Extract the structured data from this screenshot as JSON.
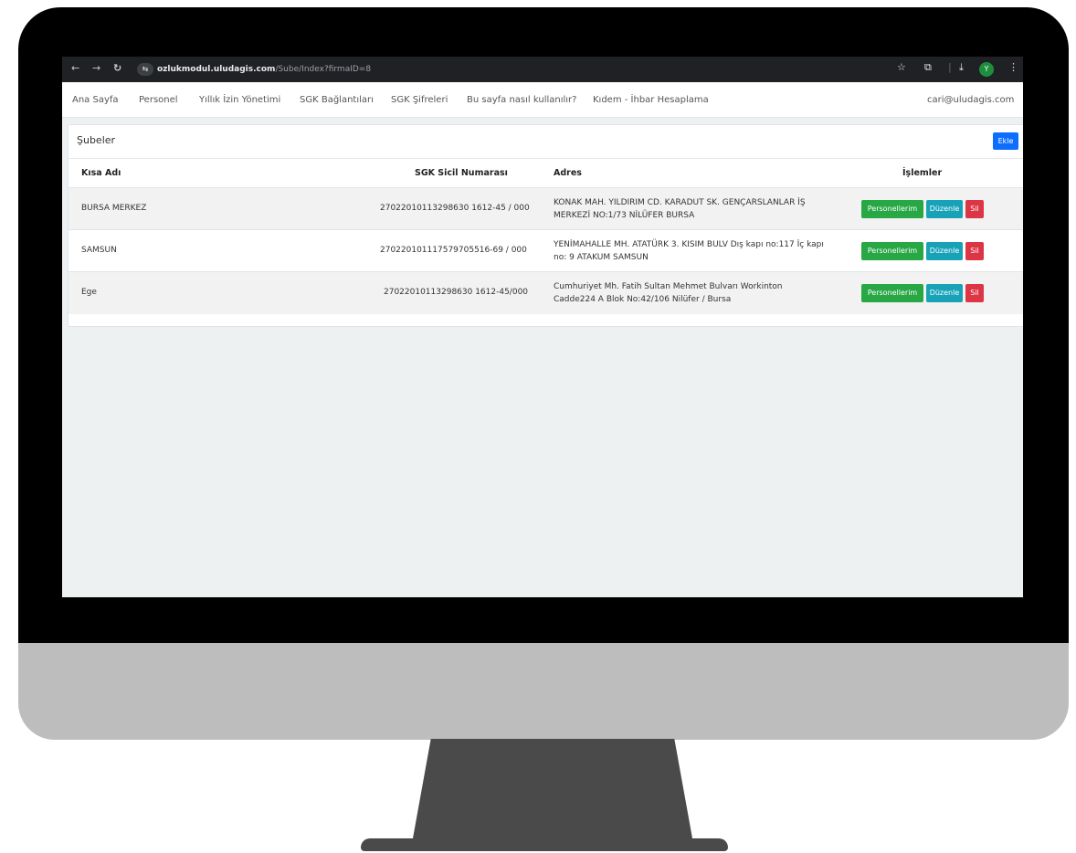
{
  "browser": {
    "url_host": "ozlukmodul.uludagis.com",
    "url_path": "/Sube/Index?firmaID=8",
    "profile_initial": "Y"
  },
  "nav": {
    "links": [
      "Ana Sayfa",
      "Personel",
      "Yıllık İzin Yönetimi",
      "SGK Bağlantıları",
      "SGK Şifreleri",
      "Bu sayfa nasıl kullanılır?",
      "Kıdem - İhbar Hesaplama"
    ],
    "user_email": "cari@uludagis.com"
  },
  "panel": {
    "title": "Şubeler",
    "add_label": "Ekle"
  },
  "table": {
    "headers": [
      "Kısa Adı",
      "SGK Sicil Numarası",
      "Adres",
      "İşlemler"
    ],
    "rows": [
      {
        "short_name": "BURSA MERKEZ",
        "sgk_no": "27022010113298630 1612-45 / 000",
        "address_1": "KONAK MAH. YILDIRIM CD. KARADUT SK. GENÇARSLANLAR İŞ",
        "address_2": "MERKEZİ NO:1/73 NİLÜFER BURSA"
      },
      {
        "short_name": "SAMSUN",
        "sgk_no": "270220101117579705516-69 / 000",
        "address_1": "YENİMAHALLE MH. ATATÜRK 3. KISIM BULV Dış kapı no:117 İç kapı",
        "address_2": "no: 9 ATAKUM SAMSUN"
      },
      {
        "short_name": "Ege",
        "sgk_no": "27022010113298630 1612-45/000",
        "address_1": "Cumhuriyet Mh. Fatih Sultan Mehmet Bulvarı Workinton",
        "address_2": "Cadde224 A Blok No:42/106 Nilüfer / Bursa"
      }
    ],
    "actions": {
      "staff": "Personellerim",
      "edit": "Düzenle",
      "delete": "Sil"
    }
  },
  "colors": {
    "primary": "#0d6efd",
    "success": "#28a745",
    "info": "#17a2b8",
    "danger": "#dc3545"
  }
}
